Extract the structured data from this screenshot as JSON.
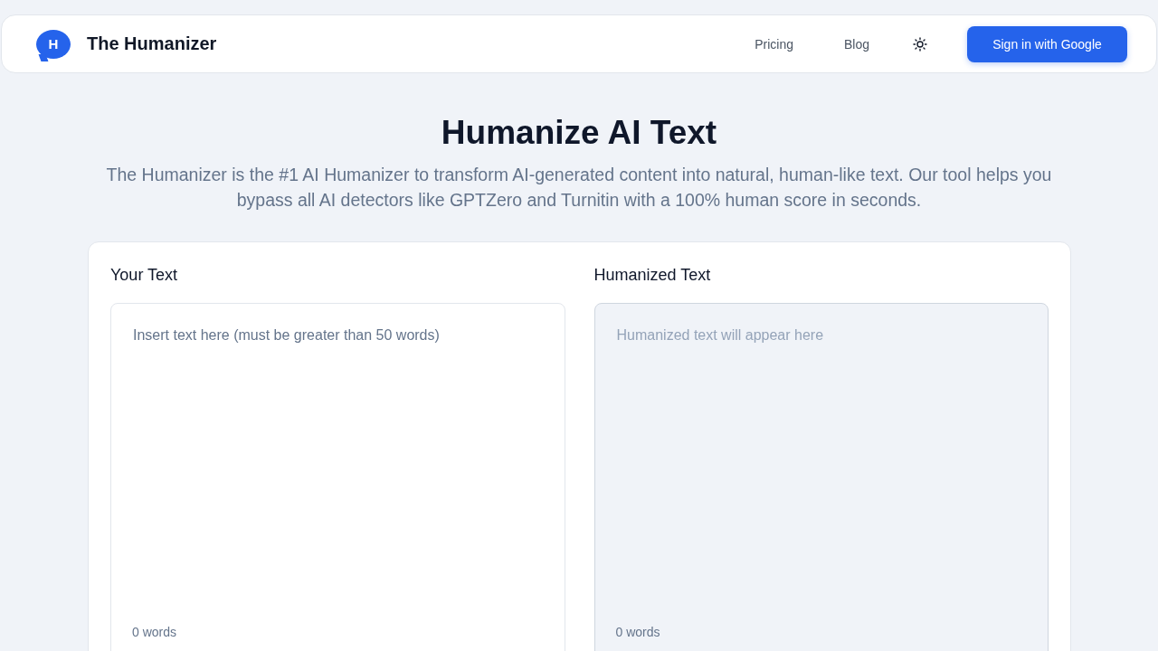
{
  "header": {
    "logo_letter": "H",
    "brand": "The Humanizer",
    "nav": [
      {
        "label": "Pricing"
      },
      {
        "label": "Blog"
      }
    ],
    "sign_in": "Sign in with Google"
  },
  "hero": {
    "title": "Humanize AI Text",
    "subtitle": "The Humanizer is the #1 AI Humanizer to transform AI-generated content into natural, human-like text. Our tool helps you bypass all AI detectors like GPTZero and Turnitin with a 100% human score in seconds."
  },
  "panels": [
    {
      "heading": "Your Text",
      "placeholder": "Insert text here (must be greater than 50 words)",
      "readonly": false,
      "word_count": "0 words"
    },
    {
      "heading": "Humanized Text",
      "placeholder": "Humanized text will appear here",
      "readonly": true,
      "word_count": "0 words"
    }
  ]
}
